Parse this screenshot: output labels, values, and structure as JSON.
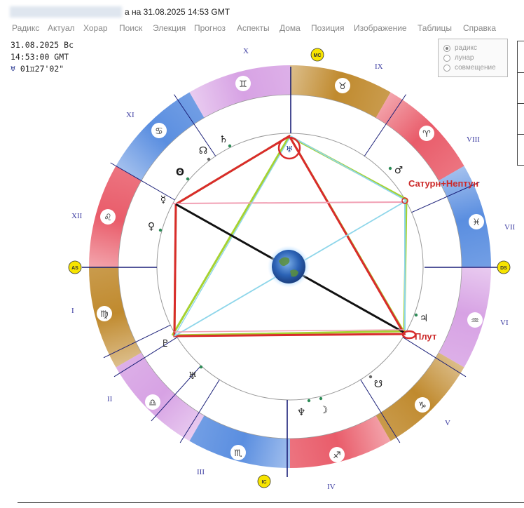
{
  "window": {
    "title": "а на 31.08.2025  14:53 GMT"
  },
  "menu": [
    {
      "label": "Радикс"
    },
    {
      "label": "Актуал"
    },
    {
      "label": "Хорар"
    },
    {
      "label": "Поиск"
    },
    {
      "label": "Элекция"
    },
    {
      "label": "Прогноз"
    },
    {
      "label": "Аспекты"
    },
    {
      "label": "Дома"
    },
    {
      "label": "Позиция"
    },
    {
      "label": "Изображение"
    },
    {
      "label": "Таблицы"
    },
    {
      "label": "Справка"
    }
  ],
  "info": {
    "date": "31.08.2025 Вс",
    "time": "14:53:00 GMT",
    "node_symbol": "♅",
    "node_position": "01♊27'02\""
  },
  "chart_mode": {
    "options": [
      "радикс",
      "лунар",
      "совмещение"
    ],
    "selected": "радикс"
  },
  "axes": {
    "mc": "MC",
    "ic": "IC",
    "as": "AS",
    "ds": "DS"
  },
  "houses": [
    "I",
    "II",
    "III",
    "IV",
    "V",
    "VI",
    "VII",
    "VIII",
    "IX",
    "X",
    "XI",
    "XII"
  ],
  "zodiac": [
    {
      "glyph": "♉"
    },
    {
      "glyph": "♈"
    },
    {
      "glyph": "♓"
    },
    {
      "glyph": "♒"
    },
    {
      "glyph": "♑"
    },
    {
      "glyph": "♐"
    },
    {
      "glyph": "♏"
    },
    {
      "glyph": "♎"
    },
    {
      "glyph": "♍"
    },
    {
      "glyph": "♌"
    },
    {
      "glyph": "♋"
    },
    {
      "glyph": "♊"
    }
  ],
  "planets": [
    {
      "glyph": "♄",
      "name": "saturn"
    },
    {
      "glyph": "☊",
      "name": "north-node"
    },
    {
      "glyph": "ʘ",
      "name": "sun"
    },
    {
      "glyph": "☿",
      "name": "mercury"
    },
    {
      "glyph": "♀",
      "name": "venus"
    },
    {
      "glyph": "♂",
      "name": "mars"
    },
    {
      "glyph": "♃",
      "name": "jupiter"
    },
    {
      "glyph": "♇",
      "name": "pluto"
    },
    {
      "glyph": "♅",
      "name": "uranus"
    },
    {
      "glyph": "♆",
      "name": "neptune"
    },
    {
      "glyph": "☽",
      "name": "moon"
    },
    {
      "glyph": "☋",
      "name": "south-node"
    },
    {
      "glyph": "♅",
      "name": "uranus-top"
    }
  ],
  "annotations": {
    "saturn_neptune": "Сатурн+Нептун",
    "pluto": "Плут"
  },
  "colors": {
    "fire": "#e95c6a",
    "earth": "#c08a2e",
    "air": "#d7a2e4",
    "water": "#5a8ee0",
    "aspect_red": "#d92b2b",
    "aspect_green": "#a6d231",
    "aspect_blue": "#7fd0e6",
    "aspect_pink": "#f1a0b4",
    "aspect_black": "#111111",
    "axis_yellow": "#f7e400"
  }
}
